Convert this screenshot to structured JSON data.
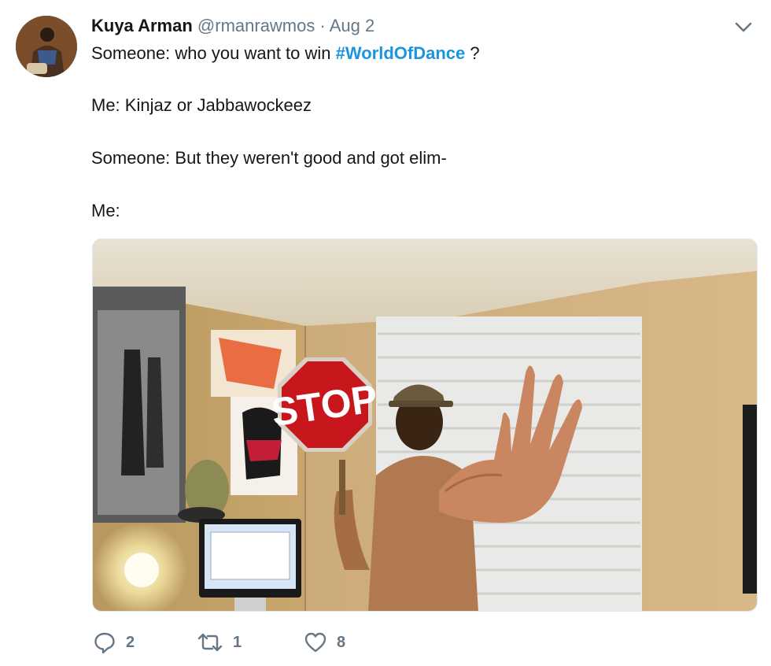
{
  "tweet": {
    "author_name": "Kuya Arman",
    "author_handle": "@rmanrawmos",
    "separator": "·",
    "timestamp": "Aug 2",
    "line1_prefix": "Someone: who you want to win ",
    "hashtag": "#WorldOfDance",
    "line1_suffix": " ?",
    "line2": "Me: Kinjaz or Jabbawockeez",
    "line3": "Someone: But they weren't good and got elim-",
    "line4": "Me:",
    "media": {
      "sign_text": "STOP"
    }
  },
  "actions": {
    "replies": "2",
    "retweets": "1",
    "likes": "8"
  },
  "icons": {
    "reply": "reply-icon",
    "retweet": "retweet-icon",
    "like": "heart-icon",
    "caret": "chevron-down-icon"
  },
  "colors": {
    "hashtag": "#1b95e0",
    "secondary_text": "#657786",
    "sign_red": "#c8161d"
  }
}
